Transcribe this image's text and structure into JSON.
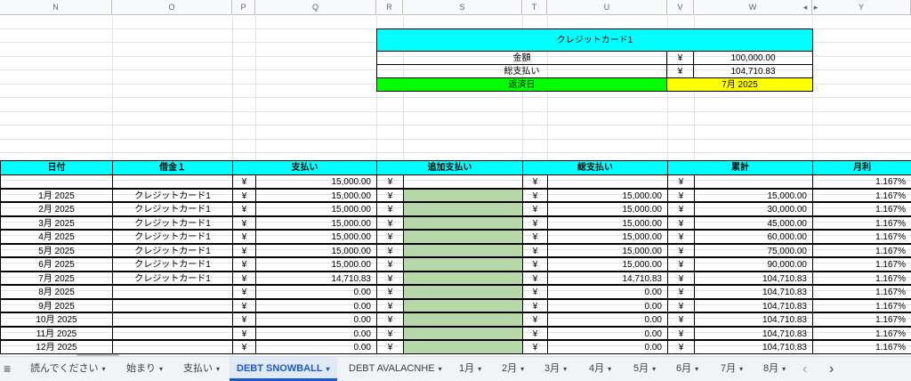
{
  "columns": [
    "N",
    "O",
    "P",
    "Q",
    "R",
    "S",
    "T",
    "U",
    "V",
    "W",
    "Y"
  ],
  "summary": {
    "title": "クレジットカード1",
    "amount_label": "金額",
    "amount_currency": "¥",
    "amount_value": "100,000.00",
    "total_label": "総支払い",
    "total_currency": "¥",
    "total_value": "104,710.83",
    "due_label": "返済日",
    "due_value": "7月 2025"
  },
  "table": {
    "headers": [
      "日付",
      "借金１",
      "支払い",
      "追加支払い",
      "総支払い",
      "累計",
      "月利"
    ],
    "rows": [
      {
        "date": "",
        "debt": "",
        "pay_c": "¥",
        "pay": "15,000.00",
        "extra_c": "¥",
        "total_c": "¥",
        "total": "",
        "cum_c": "¥",
        "cum": "",
        "rate": "1.167%"
      },
      {
        "date": "1月 2025",
        "debt": "クレジットカード1",
        "pay_c": "¥",
        "pay": "15,000.00",
        "extra_c": "¥",
        "total_c": "¥",
        "total": "15,000.00",
        "cum_c": "¥",
        "cum": "15,000.00",
        "rate": "1.167%"
      },
      {
        "date": "2月 2025",
        "debt": "クレジットカード1",
        "pay_c": "¥",
        "pay": "15,000.00",
        "extra_c": "¥",
        "total_c": "¥",
        "total": "15,000.00",
        "cum_c": "¥",
        "cum": "30,000.00",
        "rate": "1.167%"
      },
      {
        "date": "3月 2025",
        "debt": "クレジットカード1",
        "pay_c": "¥",
        "pay": "15,000.00",
        "extra_c": "¥",
        "total_c": "¥",
        "total": "15,000.00",
        "cum_c": "¥",
        "cum": "45,000.00",
        "rate": "1.167%"
      },
      {
        "date": "4月 2025",
        "debt": "クレジットカード1",
        "pay_c": "¥",
        "pay": "15,000.00",
        "extra_c": "¥",
        "total_c": "¥",
        "total": "15,000.00",
        "cum_c": "¥",
        "cum": "60,000.00",
        "rate": "1.167%"
      },
      {
        "date": "5月 2025",
        "debt": "クレジットカード1",
        "pay_c": "¥",
        "pay": "15,000.00",
        "extra_c": "¥",
        "total_c": "¥",
        "total": "15,000.00",
        "cum_c": "¥",
        "cum": "75,000.00",
        "rate": "1.167%"
      },
      {
        "date": "6月 2025",
        "debt": "クレジットカード1",
        "pay_c": "¥",
        "pay": "15,000.00",
        "extra_c": "¥",
        "total_c": "¥",
        "total": "15,000.00",
        "cum_c": "¥",
        "cum": "90,000.00",
        "rate": "1.167%"
      },
      {
        "date": "7月 2025",
        "debt": "クレジットカード1",
        "pay_c": "¥",
        "pay": "14,710.83",
        "extra_c": "¥",
        "total_c": "¥",
        "total": "14,710.83",
        "cum_c": "¥",
        "cum": "104,710.83",
        "rate": "1.167%"
      },
      {
        "date": "8月 2025",
        "debt": "",
        "pay_c": "¥",
        "pay": "0.00",
        "extra_c": "¥",
        "total_c": "¥",
        "total": "0.00",
        "cum_c": "¥",
        "cum": "104,710.83",
        "rate": "1.167%"
      },
      {
        "date": "9月 2025",
        "debt": "",
        "pay_c": "¥",
        "pay": "0.00",
        "extra_c": "¥",
        "total_c": "¥",
        "total": "0.00",
        "cum_c": "¥",
        "cum": "104,710.83",
        "rate": "1.167%"
      },
      {
        "date": "10月 2025",
        "debt": "",
        "pay_c": "¥",
        "pay": "0.00",
        "extra_c": "¥",
        "total_c": "¥",
        "total": "0.00",
        "cum_c": "¥",
        "cum": "104,710.83",
        "rate": "1.167%"
      },
      {
        "date": "11月 2025",
        "debt": "",
        "pay_c": "¥",
        "pay": "0.00",
        "extra_c": "¥",
        "total_c": "¥",
        "total": "0.00",
        "cum_c": "¥",
        "cum": "104,710.83",
        "rate": "1.167%"
      },
      {
        "date": "12月 2025",
        "debt": "",
        "pay_c": "¥",
        "pay": "0.00",
        "extra_c": "¥",
        "total_c": "¥",
        "total": "0.00",
        "cum_c": "¥",
        "cum": "104,710.83",
        "rate": "1.167%"
      }
    ]
  },
  "tabs": [
    {
      "label": "読んでください",
      "active": false
    },
    {
      "label": "始まり",
      "active": false
    },
    {
      "label": "支払い",
      "active": false
    },
    {
      "label": "DEBT SNOWBALL",
      "active": true
    },
    {
      "label": "DEBT AVALACNHE",
      "active": false
    },
    {
      "label": "1月",
      "active": false
    },
    {
      "label": "2月",
      "active": false
    },
    {
      "label": "3月",
      "active": false
    },
    {
      "label": "4月",
      "active": false
    },
    {
      "label": "5月",
      "active": false
    },
    {
      "label": "6月",
      "active": false
    },
    {
      "label": "7月",
      "active": false
    },
    {
      "label": "8月",
      "active": false
    }
  ],
  "icons": {
    "sheet_list": "hamburger-icon",
    "tab_caret": "▾",
    "prev": "‹",
    "next": "›",
    "col_nav_left": "◂",
    "col_nav_right": "▸"
  },
  "colors": {
    "header_cyan": "#00ffff",
    "due_green": "#00ff00",
    "due_yellow": "#ffff00",
    "extra_green": "#b6d7a8",
    "active_tab": "#1a5ac8"
  }
}
